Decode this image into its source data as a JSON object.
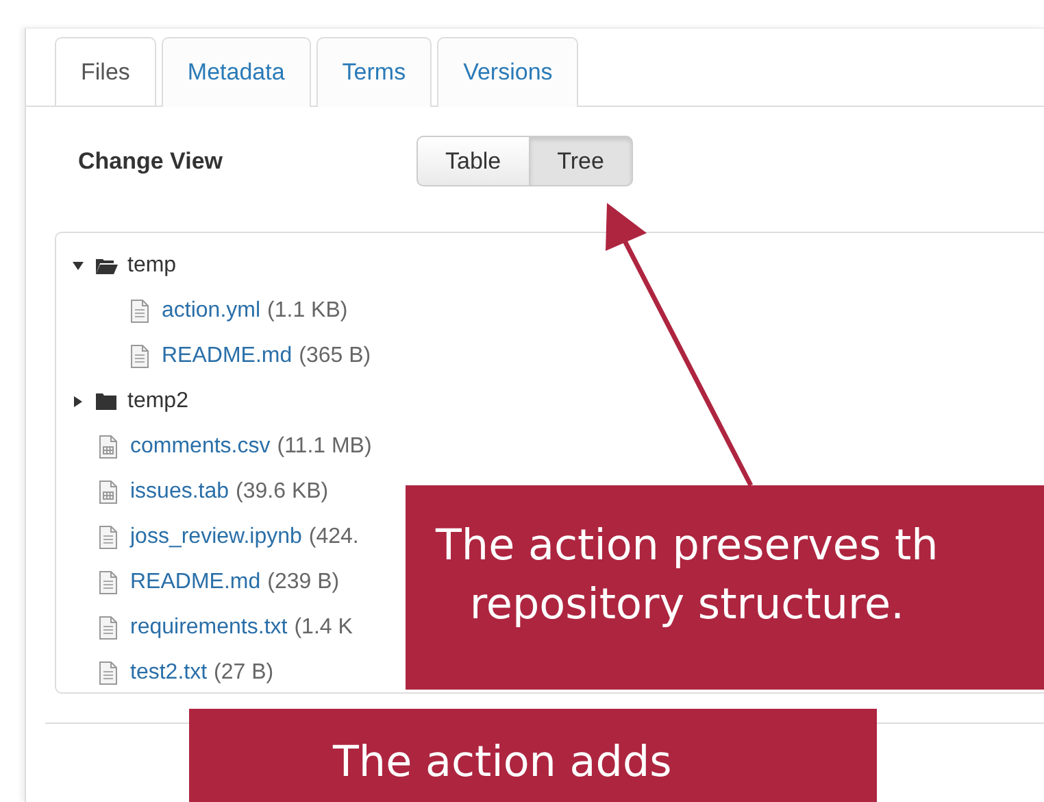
{
  "tabs": [
    {
      "label": "Files",
      "selected": true
    },
    {
      "label": "Metadata",
      "selected": false
    },
    {
      "label": "Terms",
      "selected": false
    },
    {
      "label": "Versions",
      "selected": false
    }
  ],
  "view_label": "Change View",
  "view_buttons": [
    {
      "label": "Table",
      "selected": false
    },
    {
      "label": "Tree",
      "selected": true
    }
  ],
  "tree": [
    {
      "kind": "folder",
      "name": "temp",
      "expanded": true,
      "children": [
        {
          "kind": "text_file",
          "name": "action.yml",
          "size": "(1.1 KB)"
        },
        {
          "kind": "text_file",
          "name": "README.md",
          "size": "(365 B)"
        }
      ]
    },
    {
      "kind": "folder",
      "name": "temp2",
      "expanded": false
    },
    {
      "kind": "table_file",
      "name": "comments.csv",
      "size": "(11.1 MB)"
    },
    {
      "kind": "table_file",
      "name": "issues.tab",
      "size": "(39.6 KB)"
    },
    {
      "kind": "text_file",
      "name": "joss_review.ipynb",
      "size": "(424."
    },
    {
      "kind": "text_file",
      "name": "README.md",
      "size": "(239 B)"
    },
    {
      "kind": "text_file",
      "name": "requirements.txt",
      "size": "(1.4 K"
    },
    {
      "kind": "text_file",
      "name": "test2.txt",
      "size": "(27 B)"
    }
  ],
  "callouts": [
    {
      "lines": [
        "The action preserves th",
        "repository structure."
      ]
    },
    {
      "lines": [
        "The action adds"
      ]
    }
  ]
}
